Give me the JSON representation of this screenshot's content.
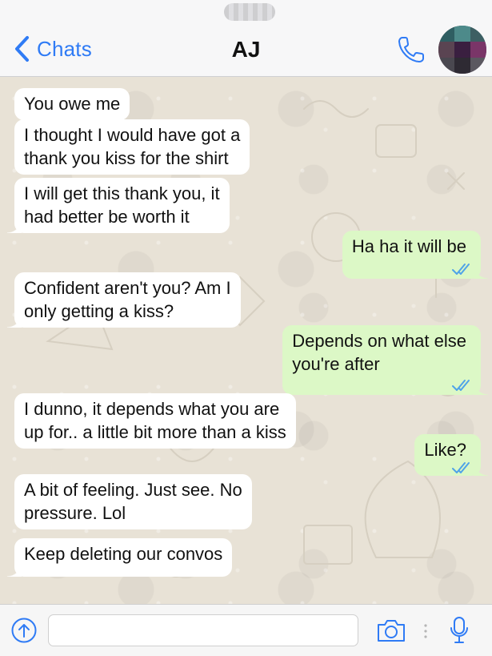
{
  "header": {
    "back_label": "Chats",
    "title": "AJ",
    "back_icon": "chevron-left-icon",
    "call_icon": "phone-icon",
    "avatar": "contact-avatar-blurred"
  },
  "messages": [
    {
      "direction": "incoming",
      "text_lines": [
        "You owe me"
      ],
      "tail": false
    },
    {
      "direction": "incoming",
      "text_lines": [
        "I thought I would have got a",
        "thank you kiss for the shirt"
      ],
      "tail": false
    },
    {
      "direction": "incoming",
      "text_lines": [
        "I will get this thank you, it",
        "had better be worth it"
      ],
      "tail": true
    },
    {
      "direction": "outgoing",
      "text_lines": [
        "Ha ha it will be"
      ],
      "tail": true,
      "read": true
    },
    {
      "direction": "incoming",
      "text_lines": [
        "Confident aren't you? Am I",
        "only getting a kiss?"
      ],
      "tail": true
    },
    {
      "direction": "outgoing",
      "text_lines": [
        "Depends on what else",
        "you're after"
      ],
      "tail": true,
      "read": true
    },
    {
      "direction": "incoming",
      "text_lines": [
        "I dunno, it depends what you are",
        "up for.. a little bit more than a kiss"
      ],
      "tail": false
    },
    {
      "direction": "outgoing",
      "text_lines": [
        "Like?"
      ],
      "tail": true,
      "read": true
    },
    {
      "direction": "incoming",
      "text_lines": [
        "A bit of feeling. Just see. No",
        "pressure. Lol"
      ],
      "tail": false
    },
    {
      "direction": "incoming",
      "text_lines": [
        "Keep deleting our convos"
      ],
      "tail": true
    }
  ],
  "input_bar": {
    "upload_icon": "upload-arrow-icon",
    "message_value": "",
    "camera_icon": "camera-icon",
    "mic_icon": "microphone-icon"
  },
  "colors": {
    "accent": "#2f7bf5",
    "outgoing_bubble": "#dcf8c6",
    "incoming_bubble": "#ffffff",
    "chat_background": "#e8e2d6",
    "read_ticks": "#4fa3e8"
  }
}
